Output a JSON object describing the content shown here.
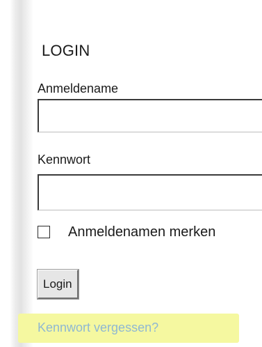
{
  "login": {
    "title": "LOGIN",
    "username_label": "Anmeldename",
    "username_value": "",
    "username_placeholder": "",
    "password_label": "Kennwort",
    "password_value": "",
    "remember_label": "Anmeldenamen merken",
    "remember_checked": false,
    "login_button_label": "Login",
    "forgot_password_link": "Kennwort vergessen?"
  },
  "colors": {
    "link": "#8fb8d2",
    "highlight": "#f5f8a0",
    "button_bg": "#e6e6e6"
  }
}
